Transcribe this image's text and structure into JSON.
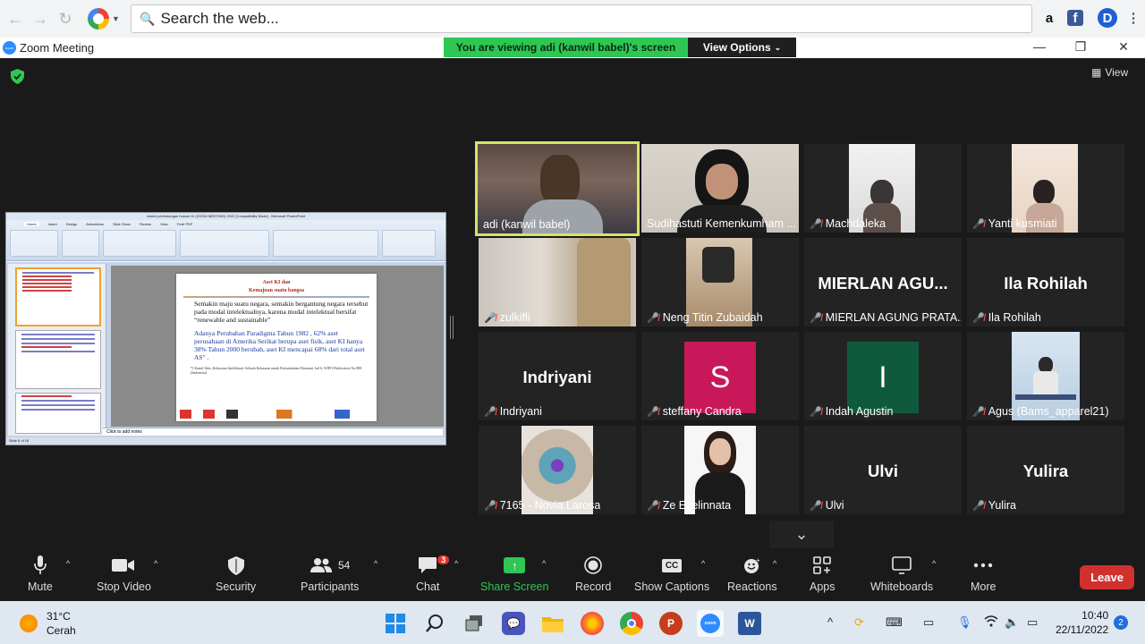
{
  "browser": {
    "search_placeholder": "Search the web...",
    "extensions": [
      "amazon-icon",
      "facebook-icon",
      "d-icon"
    ]
  },
  "zoom": {
    "window_title": "Zoom Meeting",
    "viewing_banner": "You are viewing adi (kanwil babel)'s screen",
    "view_options": "View Options",
    "view_label": "View"
  },
  "shared_screen": {
    "ppt_window_title": "materi perlindungan hukum KI (ZOOM MEETING) 2022 [Compatibility Mode] - Microsoft PowerPoint",
    "ppt_tabs": [
      "Home",
      "Insert",
      "Design",
      "Animations",
      "Slide Show",
      "Review",
      "View",
      "Foxit PDF"
    ],
    "slide": {
      "title_line1": "Aset KI dan",
      "title_line2": "Kemajuan suatu bangsa",
      "bullet1": "Semakin maju suatu negara, semakin bergantung negara tersebut pada modal intelektualnya, karena modal intelektual bersifat “renewable and sustainable”",
      "bullet2": "Adanya Perubahan Paradigma Tahun 1982 , 62% aset perusahaan di Amerika Serikat berupa aset fisik, aset KI hanya 38% Tahun 2000 berubah, aset KI mencapai 68% dari total aset AS\" .",
      "footnote": "*) Kamil Idris, Kekayaan Intelektual: Sebuah Kekuatan untuk Pertumbuhan Ekonomi, hal 6, WIPO Publication No.888 (Indonesia)"
    },
    "notes_placeholder": "Click to add notes",
    "status": "Slide 6 of 16"
  },
  "participants_tiles": [
    {
      "name": "adi (kanwil babel)",
      "muted": false,
      "type": "video",
      "active": true
    },
    {
      "name": "Sudihastuti Kemenkumham ...",
      "muted": false,
      "type": "video"
    },
    {
      "name": "Machdaleka",
      "muted": true,
      "type": "video"
    },
    {
      "name": "Yanti kusmiati",
      "muted": true,
      "type": "video"
    },
    {
      "name": "zulkifli",
      "muted": true,
      "type": "video"
    },
    {
      "name": "Neng Titin Zubaidah",
      "muted": true,
      "type": "video"
    },
    {
      "name": "MIERLAN AGUNG PRATA...",
      "muted": true,
      "type": "text",
      "display": "MIERLAN  AGU..."
    },
    {
      "name": "Ila Rohilah",
      "muted": true,
      "type": "text",
      "display": "Ila Rohilah"
    },
    {
      "name": "Indriyani",
      "muted": true,
      "type": "text",
      "display": "Indriyani"
    },
    {
      "name": "steffany Candra",
      "muted": true,
      "type": "avatar",
      "letter": "S",
      "color": "#c8185a"
    },
    {
      "name": "Indah Agustin",
      "muted": true,
      "type": "avatar",
      "letter": "I",
      "color": "#0f5a3c"
    },
    {
      "name": "Agus (Bams_apparel21)",
      "muted": true,
      "type": "video"
    },
    {
      "name": "7165 - Novia Larosa",
      "muted": true,
      "type": "video"
    },
    {
      "name": "Ze Ezelinnata",
      "muted": true,
      "type": "video"
    },
    {
      "name": "Ulvi",
      "muted": true,
      "type": "text",
      "display": "Ulvi"
    },
    {
      "name": "Yulira",
      "muted": true,
      "type": "text",
      "display": "Yulira"
    }
  ],
  "toolbar": {
    "mute": "Mute",
    "stop_video": "Stop Video",
    "security": "Security",
    "participants": "Participants",
    "participants_count": "54",
    "chat": "Chat",
    "chat_badge": "3",
    "share_screen": "Share Screen",
    "record": "Record",
    "show_captions": "Show Captions",
    "captions_icon": "CC",
    "reactions": "Reactions",
    "apps": "Apps",
    "whiteboards": "Whiteboards",
    "more": "More",
    "leave": "Leave"
  },
  "taskbar": {
    "temperature": "31°C",
    "weather": "Cerah",
    "time": "10:40",
    "date": "22/11/2022",
    "notifications": "2"
  },
  "colors": {
    "active_speaker": "#d3e46a",
    "banner_green": "#2ec754",
    "leave_red": "#d0312d",
    "muted_red": "#ff4a4a"
  }
}
